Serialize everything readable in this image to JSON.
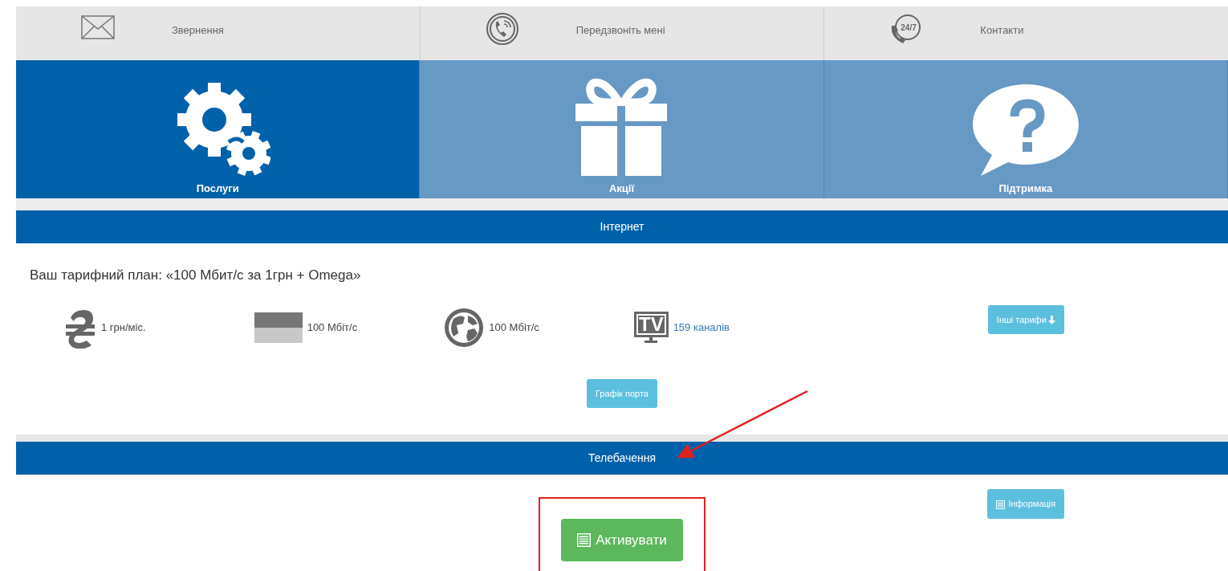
{
  "contact_bar": [
    {
      "kind": "envelope",
      "label": "Звернення"
    },
    {
      "kind": "phone",
      "label": "Передзвоніть мені"
    },
    {
      "kind": "support247",
      "icon_text": "24/7",
      "label": "Контакти"
    }
  ],
  "tiles": [
    {
      "kind": "gears",
      "label": "Послуги",
      "selected": true
    },
    {
      "kind": "gift",
      "label": "Акції",
      "selected": false
    },
    {
      "kind": "question",
      "label": "Підтримка",
      "selected": false
    }
  ],
  "internet": {
    "title": "Інтернет",
    "plan": "Ваш тарифний план: «100 Мбит/с за 1грн + Omega»",
    "features": [
      {
        "kind": "currency",
        "text": "1 грн/міс."
      },
      {
        "kind": "speed",
        "text": "100 Мбіт/с"
      },
      {
        "kind": "globe",
        "text": "100 Мбіт/с"
      },
      {
        "kind": "tv",
        "icon_text": "TV",
        "text": "159 каналів",
        "link": true
      }
    ],
    "other_tariffs_button": "Інші тарифи",
    "port_graph_button": "Графік порта"
  },
  "tv": {
    "title": "Телебачення",
    "info_button": "Інформація",
    "activate_button": "Активувати",
    "highlighted": true
  }
}
